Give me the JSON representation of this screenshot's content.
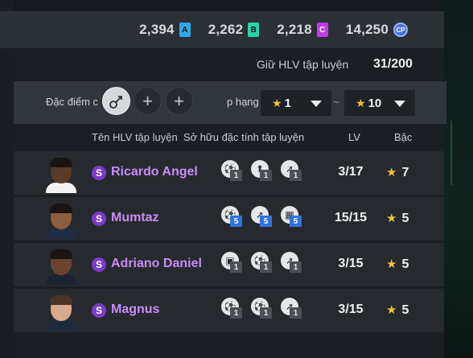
{
  "currency": [
    {
      "value": "2,394",
      "badge": "A",
      "color": "#2fa8e6"
    },
    {
      "value": "2,262",
      "badge": "B",
      "color": "#2bd3a8"
    },
    {
      "value": "2,218",
      "badge": "C",
      "color": "#c13ae6"
    },
    {
      "value": "14,250",
      "badge": "CP",
      "color": "#4a73d6"
    }
  ],
  "coach_capacity": {
    "label": "Giữ HLV tập luyện",
    "count": "31/200"
  },
  "filter": {
    "traits_label": "Đặc điểm c",
    "add_symbol": "+",
    "rank_label": "p hạng",
    "rank_min": "1",
    "rank_max": "10",
    "separator": "~"
  },
  "columns": {
    "name": "Tên HLV tập luyện",
    "traits": "Sở hữu đặc tính tập luyện",
    "lv": "LV",
    "grade": "Bậc"
  },
  "coaches": [
    {
      "initial": "S",
      "name": "Ricardo Angel",
      "traits": [
        {
          "icon": "kick-icon",
          "level": "1",
          "boost": false
        },
        {
          "icon": "header-icon",
          "level": "1",
          "boost": false
        },
        {
          "icon": "dribble-icon",
          "level": "1",
          "boost": false
        }
      ],
      "lv": "3/17",
      "grade": "7"
    },
    {
      "initial": "S",
      "name": "Mumtaz",
      "traits": [
        {
          "icon": "tackle-icon",
          "level": "5",
          "boost": true
        },
        {
          "icon": "dribble-icon",
          "level": "5",
          "boost": true
        },
        {
          "icon": "speed-icon",
          "level": "5",
          "boost": true
        }
      ],
      "lv": "15/15",
      "grade": "5"
    },
    {
      "initial": "S",
      "name": "Adriano Daniel",
      "traits": [
        {
          "icon": "keeper-icon",
          "level": "1",
          "boost": false
        },
        {
          "icon": "kick-icon",
          "level": "1",
          "boost": false
        },
        {
          "icon": "dribble-icon",
          "level": "1",
          "boost": false
        }
      ],
      "lv": "3/15",
      "grade": "5"
    },
    {
      "initial": "S",
      "name": "Magnus",
      "traits": [
        {
          "icon": "tackle-icon",
          "level": "1",
          "boost": false
        },
        {
          "icon": "kick-icon",
          "level": "1",
          "boost": false
        },
        {
          "icon": "dribble-icon",
          "level": "1",
          "boost": false
        }
      ],
      "lv": "3/15",
      "grade": "5"
    }
  ]
}
